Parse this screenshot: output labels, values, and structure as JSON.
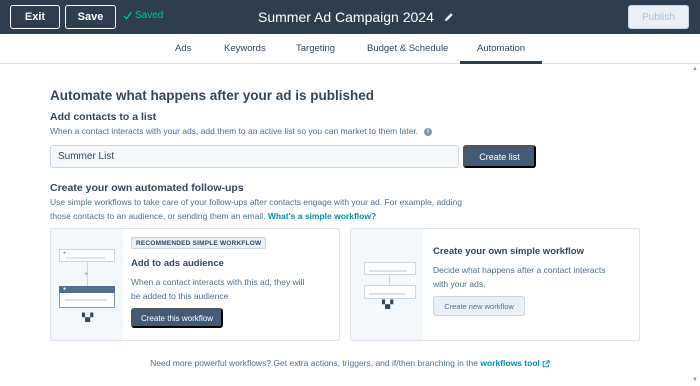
{
  "header": {
    "exit_label": "Exit",
    "save_label": "Save",
    "saved_status": "Saved",
    "campaign_title": "Summer Ad Campaign 2024",
    "publish_label": "Publish"
  },
  "tabs": [
    {
      "label": "Ads",
      "active": false
    },
    {
      "label": "Keywords",
      "active": false
    },
    {
      "label": "Targeting",
      "active": false
    },
    {
      "label": "Budget & Schedule",
      "active": false
    },
    {
      "label": "Automation",
      "active": true
    }
  ],
  "main": {
    "heading": "Automate what happens after your ad is published",
    "contacts": {
      "heading": "Add contacts to a list",
      "description": "When a contact interacts with your ads, add them to an active list so you can market to them later.",
      "list_value": "Summer List",
      "create_list_label": "Create list"
    },
    "followups": {
      "heading": "Create your own automated follow-ups",
      "description_line1": "Use simple workflows to take care of your follow-ups after contacts engage with your ad. For example, adding",
      "description_line2": "those contacts to an audience, or sending them an email.",
      "link_text": "What's a simple workflow?"
    },
    "card_recommended": {
      "badge": "RECOMMENDED SIMPLE WORKFLOW",
      "title": "Add to ads audience",
      "description_line1": "When a contact interacts with this ad, they will",
      "description_line2": "be added to this audience",
      "button_label": "Create this workflow"
    },
    "card_custom": {
      "title": "Create your own simple workflow",
      "description_line1": "Decide what happens after a contact interacts",
      "description_line2": "with your ads.",
      "button_label": "Create new workflow"
    },
    "footer": {
      "text": "Need more powerful workflows? Get extra actions, triggers, and if/then branching in the",
      "link_text": "workflows tool"
    }
  },
  "colors": {
    "topbar": "#2d3e50",
    "saved_accent": "#00bda5",
    "link": "#0091ae",
    "primary_button": "#425b76"
  }
}
